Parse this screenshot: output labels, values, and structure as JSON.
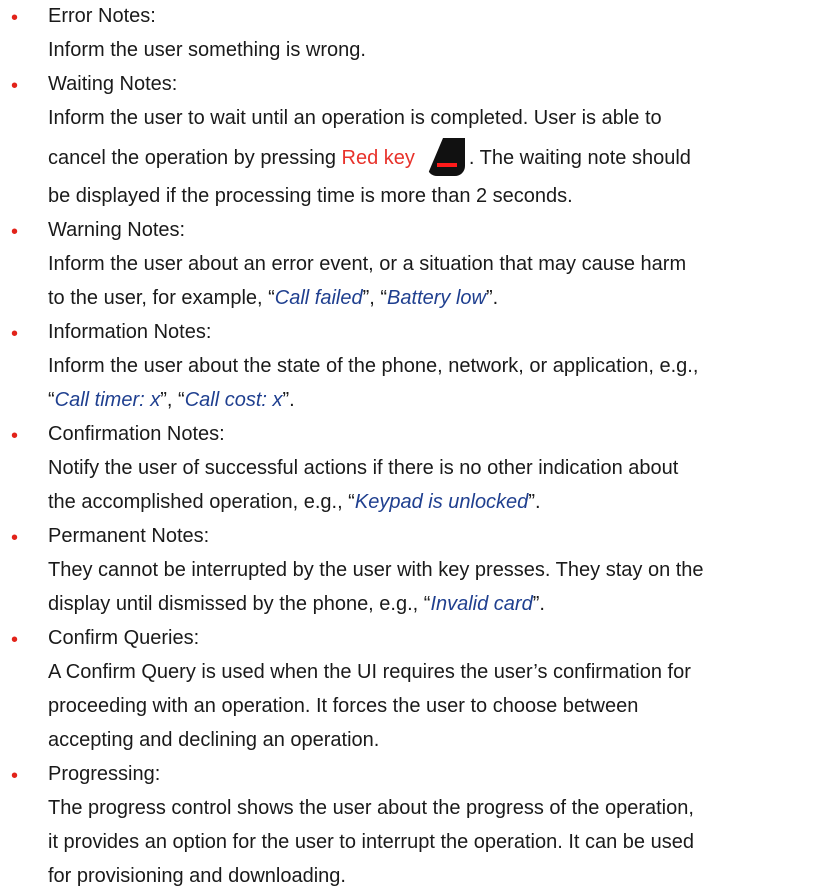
{
  "bullets": [
    {
      "title": "Error Notes:",
      "lines": [
        "Inform the user something is wrong."
      ]
    },
    {
      "title": "Waiting Notes:",
      "line1": "Inform the user to wait until an operation is completed. User is able to",
      "line2_before": "cancel the operation by pressing ",
      "line2_red": "Red key",
      "line2_after": ". The waiting note should",
      "line3": "be displayed if the processing time is more than 2 seconds.",
      "key_icon": "red-key-icon"
    },
    {
      "title": "Warning Notes:",
      "line1": "Inform the user about an error event, or a situation that may cause harm",
      "line2_a": "to the user, for example, “",
      "line2_em1": "Call failed",
      "line2_b": "”, “",
      "line2_em2": "Battery low",
      "line2_c": "”."
    },
    {
      "title": "Information Notes:",
      "line1": "Inform the user about the state of the phone, network, or application, e.g.,",
      "line2_a": "“",
      "line2_em1": "Call timer: x",
      "line2_b": "”, “",
      "line2_em2": "Call cost: x",
      "line2_c": "”."
    },
    {
      "title": "Confirmation Notes:",
      "line1": "Notify the user of successful actions if there is no other indication about",
      "line2_a": "the accomplished operation, e.g., “",
      "line2_em": "Keypad is unlocked",
      "line2_c": "”."
    },
    {
      "title": "Permanent Notes:",
      "line1": "They cannot be interrupted by the user with key presses. They stay on the",
      "line2_a": "display until dismissed by the phone, e.g., “",
      "line2_em": "Invalid card",
      "line2_c": "”."
    },
    {
      "title": "Confirm Queries:",
      "lines": [
        "A Confirm Query is used when the UI requires the user’s confirmation for",
        "proceeding with an operation. It forces the user to choose between",
        "accepting and declining an operation."
      ]
    },
    {
      "title": "Progressing:",
      "lines": [
        "The progress control shows the user about the progress of the operation,",
        "it provides an option for the user to interrupt the operation. It can be used",
        "for provisioning and downloading."
      ]
    }
  ],
  "colors": {
    "bullet": "#e2231a",
    "red_text": "#e8322b",
    "emphasis": "#1f3f8f"
  },
  "bullet_glyph": "•"
}
